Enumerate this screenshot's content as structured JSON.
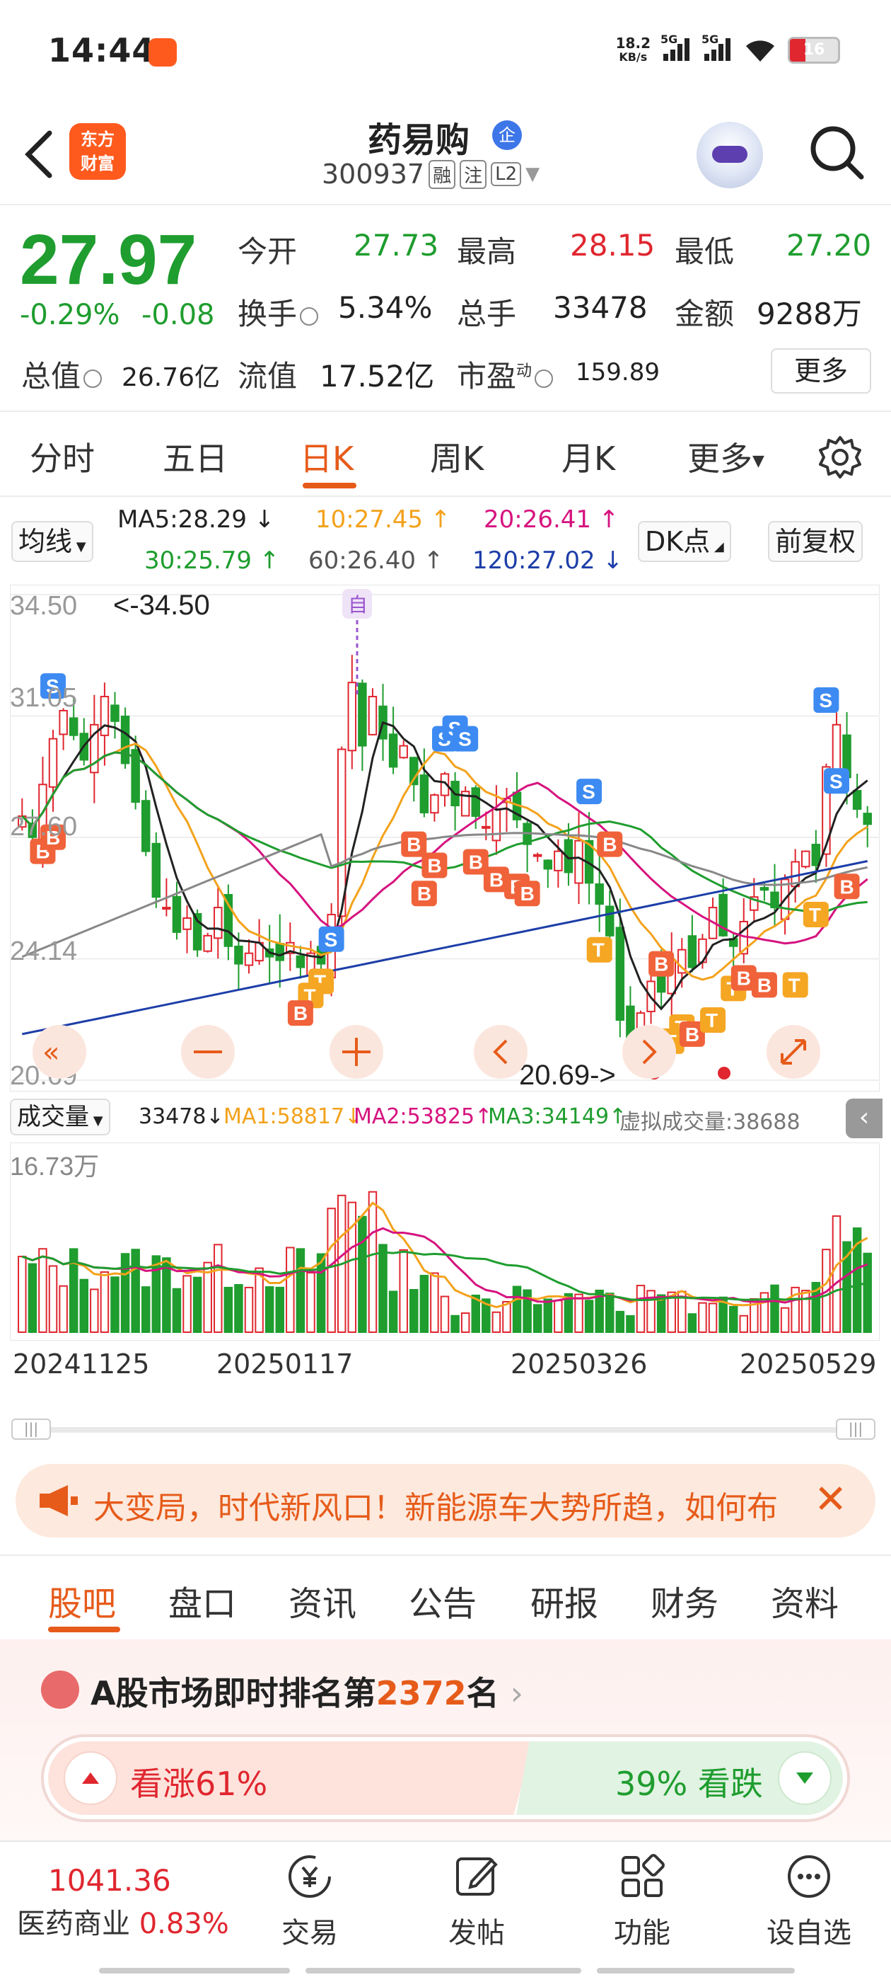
{
  "status_bar": {
    "time": "14:44",
    "net_speed_top": "18.2",
    "net_speed_bottom": "KB/s",
    "signal1": "5G",
    "signal2": "5G",
    "battery": "16"
  },
  "header": {
    "logo_line1": "东方",
    "logo_line2": "财富",
    "stock_name": "药易购",
    "badge": "企",
    "stock_code": "300937",
    "tag1": "融",
    "tag2": "注",
    "tag3": "L2"
  },
  "quote": {
    "price": "27.97",
    "change_pct": "-0.29%",
    "change_val": "-0.08",
    "open_label": "今开",
    "open": "27.73",
    "high_label": "最高",
    "high": "28.15",
    "low_label": "最低",
    "low": "27.20",
    "turnover_label": "换手",
    "turnover": "5.34%",
    "volume_label": "总手",
    "volume": "33478",
    "amount_label": "金额",
    "amount": "9288万",
    "mktcap_label": "总值",
    "mktcap": "26.76亿",
    "float_label": "流值",
    "float": "17.52亿",
    "pe_label": "市盈",
    "pe_sup": "动",
    "pe": "159.89",
    "more": "更多"
  },
  "period_tabs": [
    "分时",
    "五日",
    "日K",
    "周K",
    "月K",
    "更多"
  ],
  "active_period": 2,
  "ma_row": {
    "selector": "均线",
    "ma5": "MA5:28.29 ↓",
    "ma10": "10:27.45 ↑",
    "ma20": "20:26.41 ↑",
    "ma30": "30:25.79 ↑",
    "ma60": "60:26.40 ↑",
    "ma120": "120:27.02 ↓",
    "dk": "DK点",
    "fq": "前复权"
  },
  "chart_data": {
    "type": "candlestick",
    "y_ticks": [
      "34.50",
      "31.05",
      "27.60",
      "24.14",
      "20.69"
    ],
    "ylim": [
      20.69,
      34.5
    ],
    "max_label": "<-34.50",
    "min_label": "20.69->",
    "marker_zi": "自",
    "signal_labels": [
      "S",
      "B",
      "T"
    ],
    "candles_close": [
      28.2,
      27.6,
      29.1,
      30.4,
      31.2,
      30.5,
      29.8,
      30.8,
      31.6,
      30.9,
      29.7,
      28.6,
      27.2,
      25.9,
      25.6,
      24.9,
      25.3,
      24.4,
      24.8,
      25.6,
      24.5,
      24.0,
      24.3,
      24.6,
      24.2,
      24.1,
      24.6,
      23.9,
      24.3,
      24.0,
      25.4,
      30.1,
      32.0,
      30.2,
      31.6,
      30.4,
      29.6,
      30.2,
      29.1,
      28.3,
      28.8,
      29.4,
      28.5,
      28.9,
      28.2,
      27.9,
      28.4,
      28.7,
      28.1,
      27.4,
      27.1,
      26.7,
      27.2,
      26.6,
      27.5,
      26.3,
      25.7,
      24.8,
      22.4,
      21.9,
      22.6,
      23.5,
      23.2,
      24.1,
      24.4,
      23.9,
      24.7,
      25.6,
      24.8,
      24.5,
      25.2,
      25.9,
      26.1,
      25.6,
      26.4,
      26.9,
      27.2,
      26.8,
      29.6,
      30.8,
      29.3,
      28.4,
      27.97
    ],
    "ma_series": [
      "MA5",
      "MA10",
      "MA20",
      "MA30",
      "MA60",
      "MA120"
    ],
    "volume": {
      "header_label": "成交量",
      "vol": "33478↓",
      "ma1": "MA1:58817↓",
      "ma2": "MA2:53825↑",
      "ma3": "MA3:34149↑",
      "virtual": "虚拟成交量:38688",
      "max_tick": "16.73万"
    },
    "x_ticks": [
      "20241125",
      "20250117",
      "20250326",
      "20250529"
    ]
  },
  "banner": {
    "text": "大变局，时代新风口！新能源车大势所趋，如何布"
  },
  "content_tabs": [
    "股吧",
    "盘口",
    "资讯",
    "公告",
    "研报",
    "财务",
    "资料"
  ],
  "guba": {
    "rank_prefix": "A股市场即时排名第",
    "rank_num": "2372",
    "rank_suffix": "名",
    "up_label": "看涨",
    "up_pct": "61%",
    "down_pct": "39%",
    "down_label": "看跌"
  },
  "bottom_nav": {
    "index_value": "1041.36",
    "index_name": "医药商业",
    "index_pct": "0.83%",
    "items": [
      "交易",
      "发帖",
      "功能",
      "设自选"
    ]
  },
  "colors": {
    "up": "#e0262f",
    "down": "#1f9d2f",
    "accent": "#e65b1a"
  }
}
